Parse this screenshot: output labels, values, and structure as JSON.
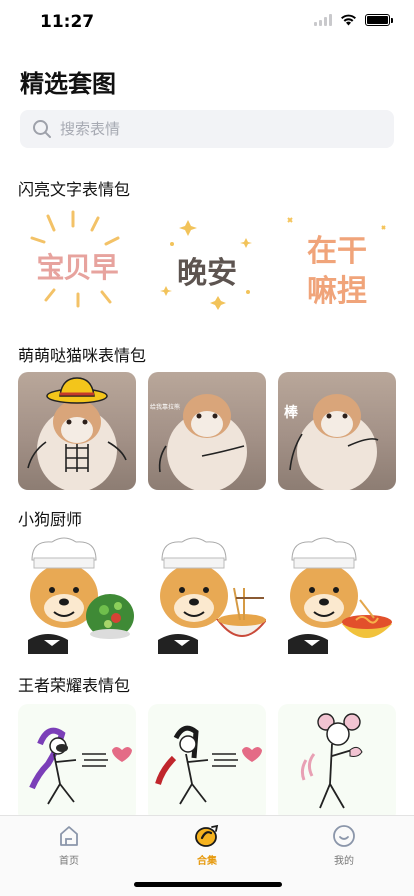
{
  "status_bar": {
    "time": "11:27"
  },
  "header": {
    "title": "精选套图"
  },
  "search": {
    "placeholder": "搜索表情"
  },
  "sections": [
    {
      "title": "闪亮文字表情包",
      "tiles": [
        {
          "text_art": "宝贝早",
          "kind": "text"
        },
        {
          "text_art": "晚安",
          "kind": "text"
        },
        {
          "text_art_line1": "在干",
          "text_art_line2": "嘛捏",
          "kind": "text"
        }
      ]
    },
    {
      "title": "萌萌哒猫咪表情包",
      "tiles": [
        {
          "kind": "cat-hat"
        },
        {
          "kind": "cat",
          "caption": "给我靠拉熊"
        },
        {
          "kind": "cat",
          "caption": "棒"
        }
      ]
    },
    {
      "title": "小狗厨师",
      "tiles": [
        {
          "kind": "dog-salad"
        },
        {
          "kind": "dog-ramen"
        },
        {
          "kind": "dog-noodle"
        }
      ]
    },
    {
      "title": "王者荣耀表情包",
      "tiles": [
        {
          "kind": "king-purple"
        },
        {
          "kind": "king-red"
        },
        {
          "kind": "king-pink"
        }
      ]
    }
  ],
  "tab_bar": {
    "items": [
      {
        "label": "首页",
        "icon": "home-icon",
        "active": false
      },
      {
        "label": "合集",
        "icon": "collection-icon",
        "active": true
      },
      {
        "label": "我的",
        "icon": "profile-icon",
        "active": false
      }
    ],
    "accent_color": "#e69a0f"
  }
}
